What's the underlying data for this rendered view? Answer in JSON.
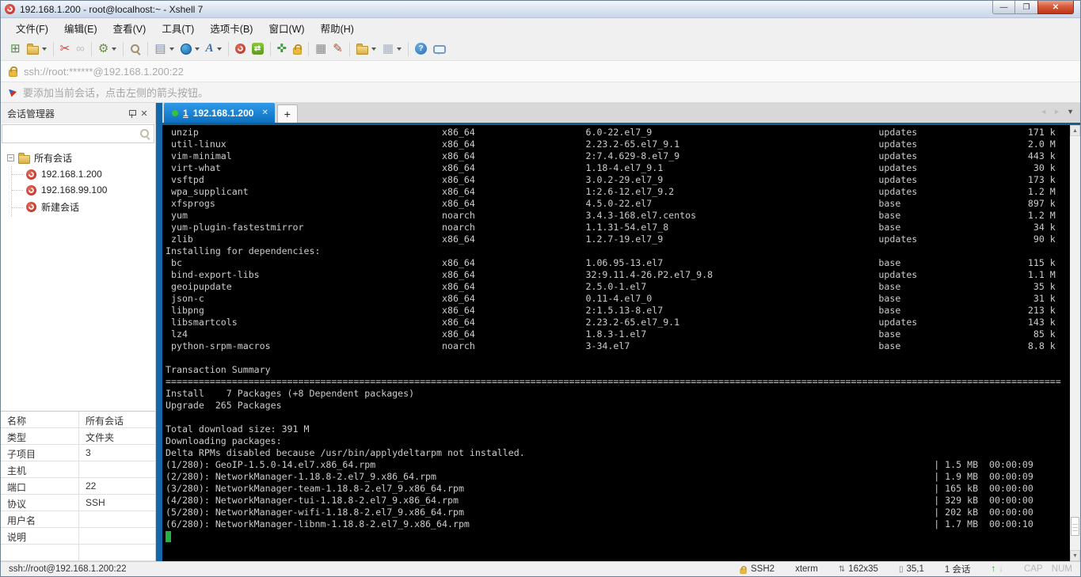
{
  "window": {
    "title": "192.168.1.200 - root@localhost:~ - Xshell 7",
    "controls": {
      "minimize": "—",
      "restore": "❐",
      "close": "✕"
    }
  },
  "menu_bar": {
    "items": [
      "文件(F)",
      "编辑(E)",
      "查看(V)",
      "工具(T)",
      "选项卡(B)",
      "窗口(W)",
      "帮助(H)"
    ]
  },
  "toolbar": {
    "icons": [
      {
        "name": "new-session",
        "glyph": "⊞"
      },
      {
        "name": "open-session-folder",
        "glyph": ""
      },
      {
        "name": "disconnect",
        "glyph": "✂"
      },
      {
        "name": "reconnect",
        "glyph": "∞"
      },
      {
        "name": "session-properties",
        "glyph": "⚙"
      },
      {
        "name": "find",
        "glyph": ""
      },
      {
        "name": "layout",
        "glyph": "▤"
      },
      {
        "name": "encoding",
        "glyph": ""
      },
      {
        "name": "font",
        "glyph": "A"
      },
      {
        "name": "xshell",
        "glyph": ""
      },
      {
        "name": "xftp",
        "glyph": "⇄"
      },
      {
        "name": "fullscreen",
        "glyph": "✜"
      },
      {
        "name": "lock-screen",
        "glyph": ""
      },
      {
        "name": "virtual-keyboard",
        "glyph": "▦"
      },
      {
        "name": "compose",
        "glyph": "✎"
      },
      {
        "name": "new-file",
        "glyph": ""
      },
      {
        "name": "tile-windows",
        "glyph": "▦"
      },
      {
        "name": "help",
        "glyph": "?"
      },
      {
        "name": "feedback",
        "glyph": ""
      }
    ]
  },
  "address_bar": {
    "value": "ssh://root:******@192.168.1.200:22"
  },
  "info_bar": {
    "message": "要添加当前会话，点击左侧的箭头按钮。"
  },
  "session_manager": {
    "title": "会话管理器",
    "pin_label": "",
    "close_glyph": "✕",
    "expander_glyph": "−",
    "root_folder": "所有会话",
    "sessions": [
      "192.168.1.200",
      "192.168.99.100",
      "新建会话"
    ],
    "properties": [
      [
        "名称",
        "所有会话"
      ],
      [
        "类型",
        "文件夹"
      ],
      [
        "子项目",
        "3"
      ],
      [
        "主机",
        ""
      ],
      [
        "端口",
        "22"
      ],
      [
        "协议",
        "SSH"
      ],
      [
        "用户名",
        ""
      ],
      [
        "说明",
        ""
      ]
    ]
  },
  "tab_bar": {
    "active_tab": {
      "number": "1",
      "label": "192.168.1.200",
      "close_glyph": "✕"
    },
    "new_tab_label": "+",
    "nav": {
      "left": "◄",
      "right": "►",
      "dropdown": "▼"
    }
  },
  "terminal": {
    "colors": {
      "background": "#000000",
      "text": "#cccccc",
      "cursor": "#25b043"
    },
    "layout": {
      "columns": 162,
      "name_col": 1,
      "arch_col": 50,
      "version_col": 76,
      "repo_col": 129,
      "size_end_col": 161,
      "pipe_col": 139
    },
    "installing_packages": [
      {
        "name": "unzip",
        "arch": "x86_64",
        "version": "6.0-22.el7_9",
        "repo": "updates",
        "size": "171 k"
      },
      {
        "name": "util-linux",
        "arch": "x86_64",
        "version": "2.23.2-65.el7_9.1",
        "repo": "updates",
        "size": "2.0 M"
      },
      {
        "name": "vim-minimal",
        "arch": "x86_64",
        "version": "2:7.4.629-8.el7_9",
        "repo": "updates",
        "size": "443 k"
      },
      {
        "name": "virt-what",
        "arch": "x86_64",
        "version": "1.18-4.el7_9.1",
        "repo": "updates",
        "size": "30 k"
      },
      {
        "name": "vsftpd",
        "arch": "x86_64",
        "version": "3.0.2-29.el7_9",
        "repo": "updates",
        "size": "173 k"
      },
      {
        "name": "wpa_supplicant",
        "arch": "x86_64",
        "version": "1:2.6-12.el7_9.2",
        "repo": "updates",
        "size": "1.2 M"
      },
      {
        "name": "xfsprogs",
        "arch": "x86_64",
        "version": "4.5.0-22.el7",
        "repo": "base",
        "size": "897 k"
      },
      {
        "name": "yum",
        "arch": "noarch",
        "version": "3.4.3-168.el7.centos",
        "repo": "base",
        "size": "1.2 M"
      },
      {
        "name": "yum-plugin-fastestmirror",
        "arch": "noarch",
        "version": "1.1.31-54.el7_8",
        "repo": "base",
        "size": "34 k"
      },
      {
        "name": "zlib",
        "arch": "x86_64",
        "version": "1.2.7-19.el7_9",
        "repo": "updates",
        "size": "90 k"
      }
    ],
    "dependencies_header": "Installing for dependencies:",
    "dependency_packages": [
      {
        "name": "bc",
        "arch": "x86_64",
        "version": "1.06.95-13.el7",
        "repo": "base",
        "size": "115 k"
      },
      {
        "name": "bind-export-libs",
        "arch": "x86_64",
        "version": "32:9.11.4-26.P2.el7_9.8",
        "repo": "updates",
        "size": "1.1 M"
      },
      {
        "name": "geoipupdate",
        "arch": "x86_64",
        "version": "2.5.0-1.el7",
        "repo": "base",
        "size": "35 k"
      },
      {
        "name": "json-c",
        "arch": "x86_64",
        "version": "0.11-4.el7_0",
        "repo": "base",
        "size": "31 k"
      },
      {
        "name": "libpng",
        "arch": "x86_64",
        "version": "2:1.5.13-8.el7",
        "repo": "base",
        "size": "213 k"
      },
      {
        "name": "libsmartcols",
        "arch": "x86_64",
        "version": "2.23.2-65.el7_9.1",
        "repo": "updates",
        "size": "143 k"
      },
      {
        "name": "lz4",
        "arch": "x86_64",
        "version": "1.8.3-1.el7",
        "repo": "base",
        "size": "85 k"
      },
      {
        "name": "python-srpm-macros",
        "arch": "noarch",
        "version": "3-34.el7",
        "repo": "base",
        "size": "8.8 k"
      }
    ],
    "transaction_summary_title": "Transaction Summary",
    "install_line": "Install    7 Packages (+8 Dependent packages)",
    "upgrade_line": "Upgrade  265 Packages",
    "total_download_line": "Total download size: 391 M",
    "downloading_line": "Downloading packages:",
    "delta_line": "Delta RPMs disabled because /usr/bin/applydeltarpm not installed.",
    "downloads": [
      {
        "label": "(1/280): GeoIP-1.5.0-14.el7.x86_64.rpm",
        "size": "1.5 MB",
        "time": "00:00:09"
      },
      {
        "label": "(2/280): NetworkManager-1.18.8-2.el7_9.x86_64.rpm",
        "size": "1.9 MB",
        "time": "00:00:09"
      },
      {
        "label": "(3/280): NetworkManager-team-1.18.8-2.el7_9.x86_64.rpm",
        "size": "165 kB",
        "time": "00:00:00"
      },
      {
        "label": "(4/280): NetworkManager-tui-1.18.8-2.el7_9.x86_64.rpm",
        "size": "329 kB",
        "time": "00:00:00"
      },
      {
        "label": "(5/280): NetworkManager-wifi-1.18.8-2.el7_9.x86_64.rpm",
        "size": "202 kB",
        "time": "00:00:00"
      },
      {
        "label": "(6/280): NetworkManager-libnm-1.18.8-2.el7_9.x86_64.rpm",
        "size": "1.7 MB",
        "time": "00:00:10"
      }
    ],
    "scrollbar": {
      "up_glyph": "▲",
      "down_glyph": "▼"
    }
  },
  "status_bar": {
    "left": "ssh://root@192.168.1.200:22",
    "protocol": "SSH2",
    "term_type": "xterm",
    "term_size": "162x35",
    "cursor_pos": "35,1",
    "session_count": "1 会话",
    "up_glyph": "↑",
    "down_glyph": "↓",
    "caps": "CAP",
    "num": "NUM",
    "size_icon_glyph": "⇅",
    "pos_icon_glyph": "▯"
  }
}
